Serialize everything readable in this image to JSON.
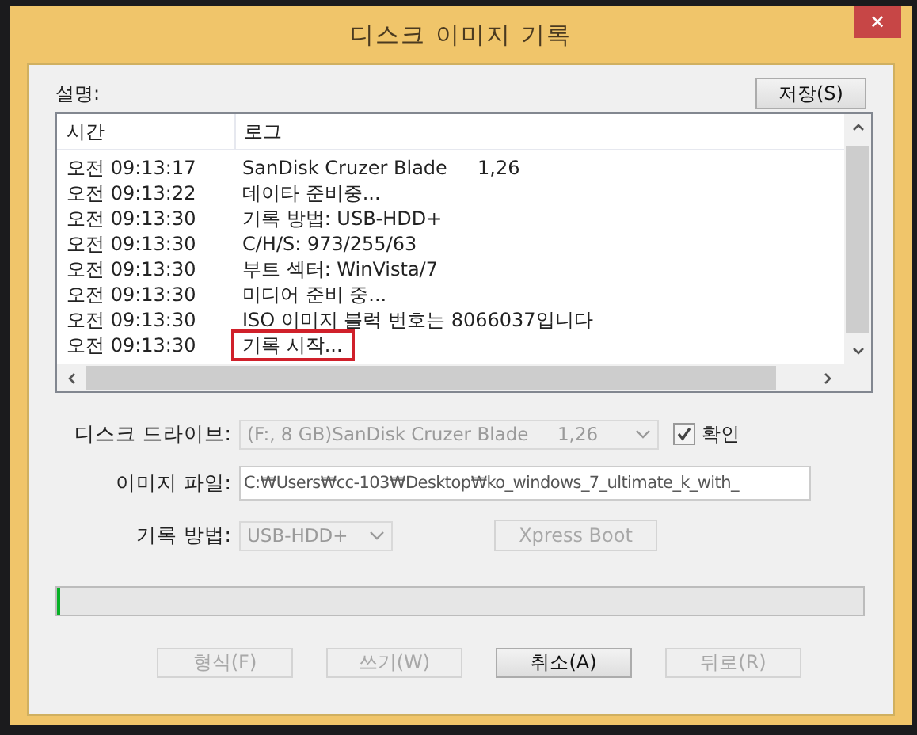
{
  "window": {
    "title": "디스크 이미지 기록",
    "close": "✕"
  },
  "description_label": "설명:",
  "save_button": {
    "label": "저장(S)",
    "disabled": false
  },
  "log": {
    "columns": [
      "시간",
      "로그"
    ],
    "rows": [
      {
        "time": "오전 09:13:17",
        "message": "SanDisk Cruzer Blade     1,26",
        "highlighted": false
      },
      {
        "time": "오전 09:13:22",
        "message": "데이타 준비중...",
        "highlighted": false
      },
      {
        "time": "오전 09:13:30",
        "message": "기록 방법: USB-HDD+",
        "highlighted": false
      },
      {
        "time": "오전 09:13:30",
        "message": "C/H/S: 973/255/63",
        "highlighted": false
      },
      {
        "time": "오전 09:13:30",
        "message": "부트 섹터: WinVista/7",
        "highlighted": false
      },
      {
        "time": "오전 09:13:30",
        "message": "미디어 준비 중...",
        "highlighted": false
      },
      {
        "time": "오전 09:13:30",
        "message": "ISO 이미지 블럭 번호는 8066037입니다",
        "highlighted": false
      },
      {
        "time": "오전 09:13:30",
        "message": "기록 시작...",
        "highlighted": true
      }
    ]
  },
  "disk_drive": {
    "label": "디스크 드라이브:",
    "value": "(F:, 8 GB)SanDisk Cruzer Blade     1,26",
    "disabled": true
  },
  "verify": {
    "label": "확인",
    "checked": true
  },
  "image_file": {
    "label": "이미지 파일:",
    "value": "C:₩Users₩cc-103₩Desktop₩ko_windows_7_ultimate_k_with_"
  },
  "write_method": {
    "label": "기록 방법:",
    "value": "USB-HDD+",
    "disabled": true
  },
  "xpress_boot": {
    "label": "Xpress Boot",
    "disabled": true
  },
  "progress": {
    "level": 0.003
  },
  "buttons": [
    {
      "label": "형식(F)",
      "disabled": true
    },
    {
      "label": "쓰기(W)",
      "disabled": true
    },
    {
      "label": "취소(A)",
      "disabled": false
    },
    {
      "label": "뒤로(R)",
      "disabled": true
    }
  ]
}
